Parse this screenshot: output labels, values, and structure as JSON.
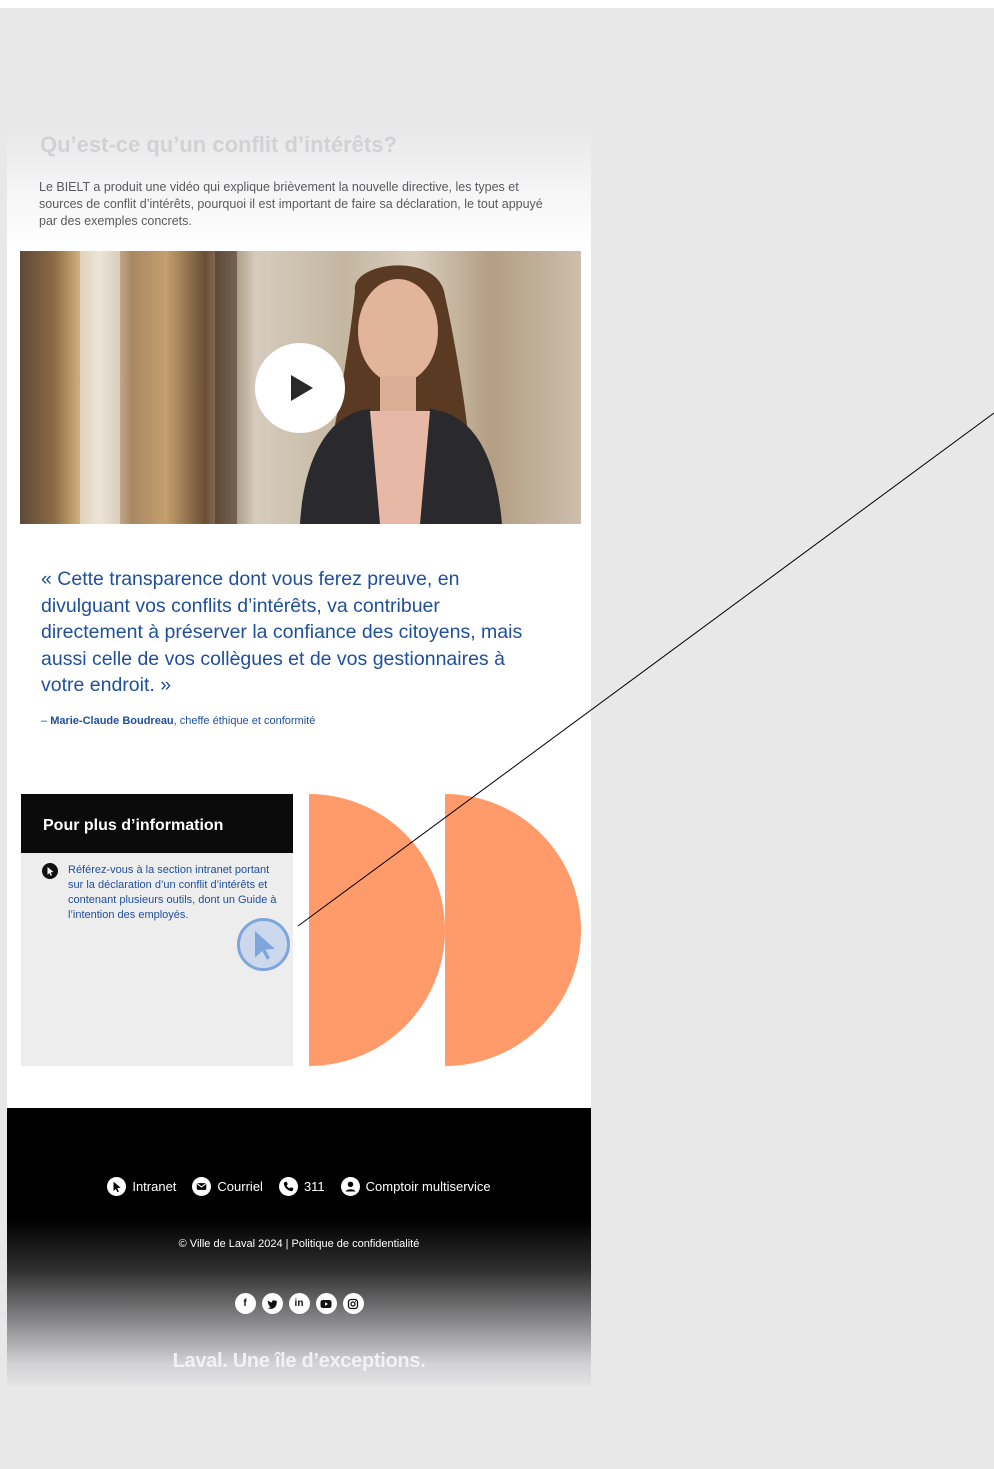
{
  "intro": {
    "title": "Qu’est-ce qu’un conflit d’intérêts?",
    "text": "Le BIELT a produit une vidéo qui explique brièvement la nouvelle directive, les types et sources de conflit d’intérêts, pourquoi il est important de faire sa déclaration, le tout appuyé par des exemples concrets."
  },
  "video": {
    "play_icon": "play-icon"
  },
  "quote": {
    "text": "« Cette transparence dont vous ferez preuve, en divulguant vos conflits d’intérêts, va contribuer directement à préserver la confiance des citoyens, mais aussi celle de vos collègues et de vos gestionnaires à votre endroit. »",
    "dash": "– ",
    "author": "Marie-Claude Boudreau",
    "role": ", cheffe éthique et conformité"
  },
  "info": {
    "title": "Pour plus d’information",
    "item": "Référez-vous à la section intranet portant sur la déclaration d’un conflit d’intérêts et contenant plusieurs outils, dont un Guide à l’intention des employés."
  },
  "footer": {
    "links": [
      {
        "label": "Intranet",
        "icon": "cursor-icon"
      },
      {
        "label": "Courriel",
        "icon": "mail-icon"
      },
      {
        "label": "311",
        "icon": "phone-icon"
      },
      {
        "label": "Comptoir multiservice",
        "icon": "user-icon"
      }
    ],
    "copyright": "© Ville de Laval 2024 | Politique de confidentialité",
    "socials": [
      "facebook-icon",
      "twitter-icon",
      "linkedin-icon",
      "youtube-icon",
      "instagram-icon"
    ],
    "tagline": "Laval. Une île d’exceptions."
  },
  "colors": {
    "quote_blue": "#1f4f9c",
    "accent_orange": "#ff9a6a",
    "cursor_blue": "#7fa6dc"
  }
}
